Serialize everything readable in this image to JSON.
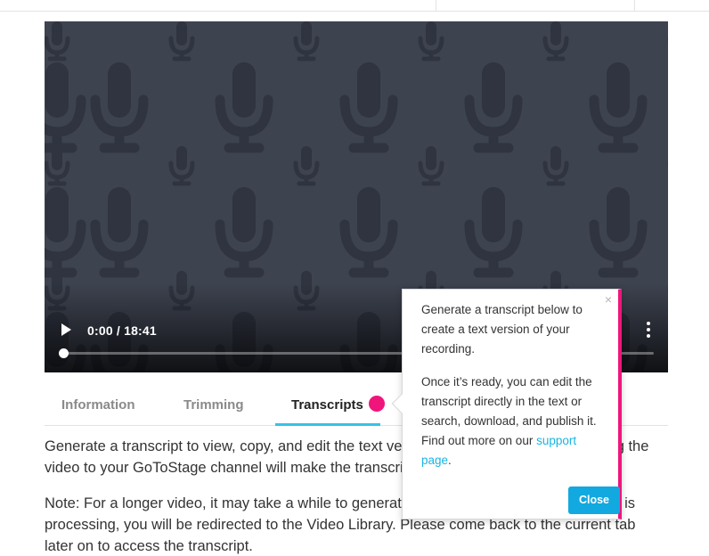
{
  "player": {
    "time_display": "0:00 / 18:41",
    "progress_fraction": 0.0,
    "play_icon": "play-icon",
    "more_icon": "more-vertical-icon",
    "background_icon": "microphone-icon"
  },
  "tabs": [
    {
      "label": "Information",
      "active": false
    },
    {
      "label": "Trimming",
      "active": false
    },
    {
      "label": "Transcripts",
      "active": true
    }
  ],
  "content": {
    "paragraph1": "Generate a transcript to view, copy, and edit the text version of your recording. Publishing the video to your GoToStage channel will make the transcript available to viewers.",
    "paragraph2": "Note: For a longer video, it may take a while to generate a transcript. While the transcript is processing, you will be redirected to the Video Library. Please come back to the current tab later on to access the transcript."
  },
  "popover": {
    "close_x": "×",
    "text1": "Generate a transcript below to create a text version of your recording.",
    "text2_before": "Once it’s ready, you can edit the transcript directly in the text or search, download, and publish it. Find out more on our ",
    "link_text": "support page",
    "text2_after": ".",
    "close_button": "Close"
  },
  "colors": {
    "accent_pink": "#f0157b",
    "tab_underline": "#35c3e6",
    "button_blue": "#11a9e0",
    "link_blue": "#18b5e3",
    "video_bg": "#3e4350"
  }
}
